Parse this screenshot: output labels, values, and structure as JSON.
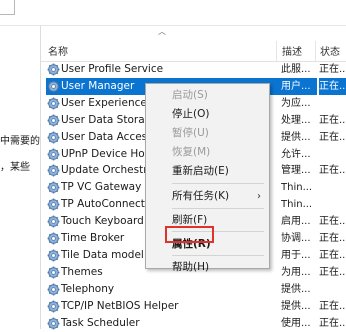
{
  "left_pane": {
    "lines": [
      "中需要的",
      "，某些"
    ]
  },
  "table": {
    "headers": {
      "name": "名称",
      "description": "描述",
      "status": "状态"
    },
    "rows": [
      {
        "name": "User Profile Service",
        "description": "此服...",
        "status": "正在..."
      },
      {
        "name": "User Manager",
        "description": "用户...",
        "status": "正在...",
        "selected": true
      },
      {
        "name": "User Experience V",
        "description": "为应...",
        "status": ""
      },
      {
        "name": "User Data Storag",
        "description": "处理...",
        "status": "正在..."
      },
      {
        "name": "User Data Access",
        "description": "提供...",
        "status": "正在..."
      },
      {
        "name": "UPnP Device Host",
        "description": "允许...",
        "status": ""
      },
      {
        "name": "Update Orchestrat",
        "description": "管理...",
        "status": "正在..."
      },
      {
        "name": "TP VC Gateway Se",
        "description": "Thin...",
        "status": ""
      },
      {
        "name": "TP AutoConnect S",
        "description": "Thin...",
        "status": ""
      },
      {
        "name": "Touch Keyboard a",
        "description": "启用...",
        "status": "正在..."
      },
      {
        "name": "Time Broker",
        "description": "协调...",
        "status": "正在..."
      },
      {
        "name": "Tile Data model s",
        "description": "用于...",
        "status": "正在..."
      },
      {
        "name": "Themes",
        "description": "为用...",
        "status": "正在..."
      },
      {
        "name": "Telephony",
        "description": "提供...",
        "status": ""
      },
      {
        "name": "TCP/IP NetBIOS Helper",
        "description": "提供...",
        "status": "正在..."
      },
      {
        "name": "Task Scheduler",
        "description": "使用...",
        "status": "正在..."
      }
    ]
  },
  "context_menu": {
    "items": [
      {
        "label": "启动(S)",
        "enabled": false
      },
      {
        "label": "停止(O)",
        "enabled": true
      },
      {
        "label": "暂停(U)",
        "enabled": false
      },
      {
        "label": "恢复(M)",
        "enabled": false
      },
      {
        "label": "重新启动(E)",
        "enabled": true
      },
      {
        "label": "所有任务(K)",
        "enabled": true,
        "submenu": true
      },
      {
        "label": "刷新(F)",
        "enabled": true
      },
      {
        "label": "属性(R)",
        "enabled": true,
        "highlighted": true
      },
      {
        "label": "帮助(H)",
        "enabled": true
      }
    ]
  },
  "colors": {
    "selection": "#0a74d0",
    "highlight_border": "#e0322b",
    "menu_bg": "#f2f2f2"
  },
  "icons": {
    "service": "gear-icon",
    "submenu": "chevron-right-icon"
  }
}
